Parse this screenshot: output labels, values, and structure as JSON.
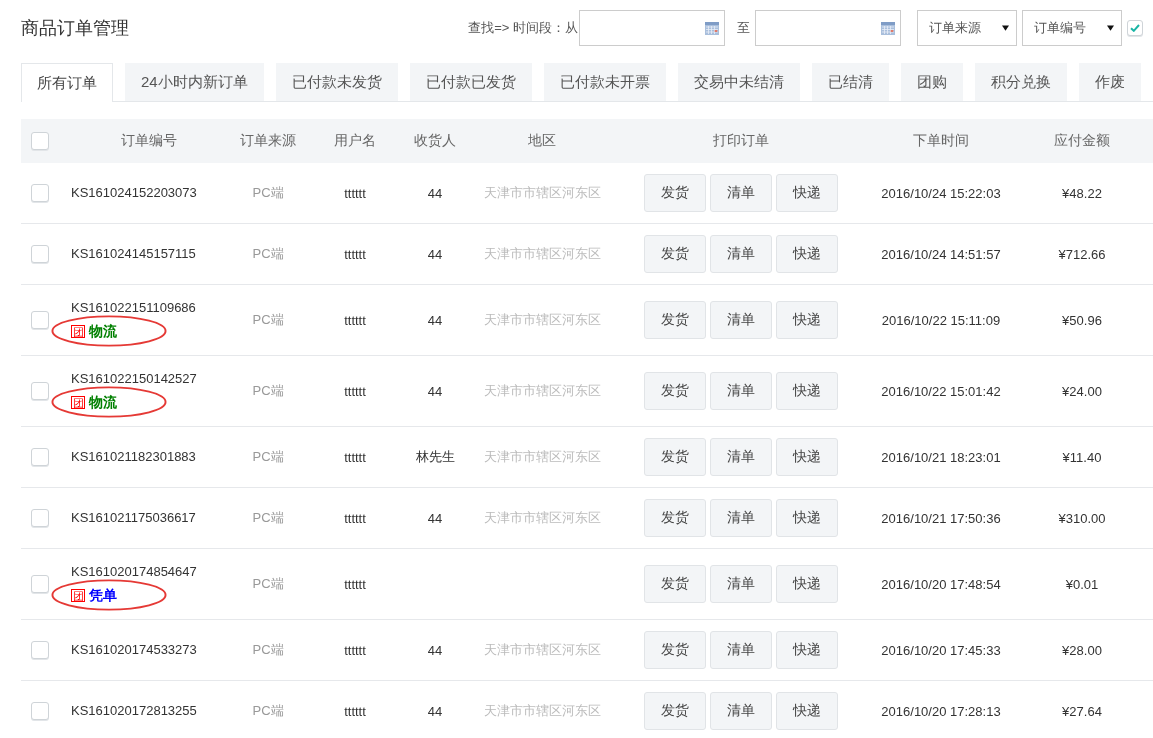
{
  "page": {
    "title": "商品订单管理"
  },
  "search": {
    "from_label": "查找=> 时间段：从",
    "to_label": "至",
    "selects": [
      {
        "value": "订单来源"
      },
      {
        "value": "订单编号"
      }
    ],
    "option_checkbox": {
      "checked": true
    }
  },
  "tabs": [
    {
      "label": "所有订单",
      "selected": true
    },
    {
      "label": "24小时内新订单",
      "selected": false
    },
    {
      "label": "已付款未发货",
      "selected": false
    },
    {
      "label": "已付款已发货",
      "selected": false
    },
    {
      "label": "已付款未开票",
      "selected": false
    },
    {
      "label": "交易中未结清",
      "selected": false
    },
    {
      "label": "已结清",
      "selected": false
    },
    {
      "label": "团购",
      "selected": false
    },
    {
      "label": "积分兑换",
      "selected": false
    },
    {
      "label": "作废",
      "selected": false
    }
  ],
  "table": {
    "select_all": {
      "checked": false
    },
    "columns": [
      "订单编号",
      "订单来源",
      "用户名",
      "收货人",
      "地区",
      "打印订单",
      "下单时间",
      "应付金额"
    ],
    "rows": [
      {
        "checked": false,
        "circled": false,
        "order_no": "KS161024152203073",
        "source": "PC端",
        "user": "tttttt",
        "consignee": "44",
        "region": "天津市市辖区河东区",
        "actions": [
          "发货",
          "清单",
          "快递"
        ],
        "time": "2016/10/24 15:22:03",
        "amount": "¥48.22"
      },
      {
        "checked": false,
        "circled": false,
        "order_no": "KS161024145157115",
        "source": "PC端",
        "user": "tttttt",
        "consignee": "44",
        "region": "天津市市辖区河东区",
        "actions": [
          "发货",
          "清单",
          "快递"
        ],
        "time": "2016/10/24 14:51:57",
        "amount": "¥712.66"
      },
      {
        "checked": false,
        "circled": true,
        "order_no": "KS161022151109686",
        "tags": [
          {
            "kind": "badge",
            "text": "团",
            "color": "#ff0000"
          },
          {
            "kind": "label",
            "text": "物流",
            "color": "#008000"
          }
        ],
        "source": "PC端",
        "user": "tttttt",
        "consignee": "44",
        "region": "天津市市辖区河东区",
        "actions": [
          "发货",
          "清单",
          "快递"
        ],
        "time": "2016/10/22 15:11:09",
        "amount": "¥50.96"
      },
      {
        "checked": false,
        "circled": true,
        "order_no": "KS161022150142527",
        "tags": [
          {
            "kind": "badge",
            "text": "团",
            "color": "#ff0000"
          },
          {
            "kind": "label",
            "text": "物流",
            "color": "#008000"
          }
        ],
        "source": "PC端",
        "user": "tttttt",
        "consignee": "44",
        "region": "天津市市辖区河东区",
        "actions": [
          "发货",
          "清单",
          "快递"
        ],
        "time": "2016/10/22 15:01:42",
        "amount": "¥24.00"
      },
      {
        "checked": false,
        "circled": false,
        "order_no": "KS161021182301883",
        "source": "PC端",
        "user": "tttttt",
        "consignee": "林先生",
        "region": "天津市市辖区河东区",
        "actions": [
          "发货",
          "清单",
          "快递"
        ],
        "time": "2016/10/21 18:23:01",
        "amount": "¥11.40"
      },
      {
        "checked": false,
        "circled": false,
        "order_no": "KS161021175036617",
        "source": "PC端",
        "user": "tttttt",
        "consignee": "44",
        "region": "天津市市辖区河东区",
        "actions": [
          "发货",
          "清单",
          "快递"
        ],
        "time": "2016/10/21 17:50:36",
        "amount": "¥310.00"
      },
      {
        "checked": false,
        "circled": true,
        "order_no": "KS161020174854647",
        "tags": [
          {
            "kind": "badge",
            "text": "团",
            "color": "#ff0000"
          },
          {
            "kind": "label",
            "text": "凭单",
            "color": "#0000ff"
          }
        ],
        "source": "PC端",
        "user": "tttttt",
        "actions": [
          "发货",
          "清单",
          "快递"
        ],
        "time": "2016/10/20 17:48:54",
        "amount": "¥0.01"
      },
      {
        "checked": false,
        "circled": false,
        "order_no": "KS161020174533273",
        "source": "PC端",
        "user": "tttttt",
        "consignee": "44",
        "region": "天津市市辖区河东区",
        "actions": [
          "发货",
          "清单",
          "快递"
        ],
        "time": "2016/10/20 17:45:33",
        "amount": "¥28.00"
      },
      {
        "checked": false,
        "circled": false,
        "order_no": "KS161020172813255",
        "source": "PC端",
        "user": "tttttt",
        "consignee": "44",
        "region": "天津市市辖区河东区",
        "actions": [
          "发货",
          "清单",
          "快递"
        ],
        "time": "2016/10/20 17:28:13",
        "amount": "¥27.64"
      }
    ]
  }
}
